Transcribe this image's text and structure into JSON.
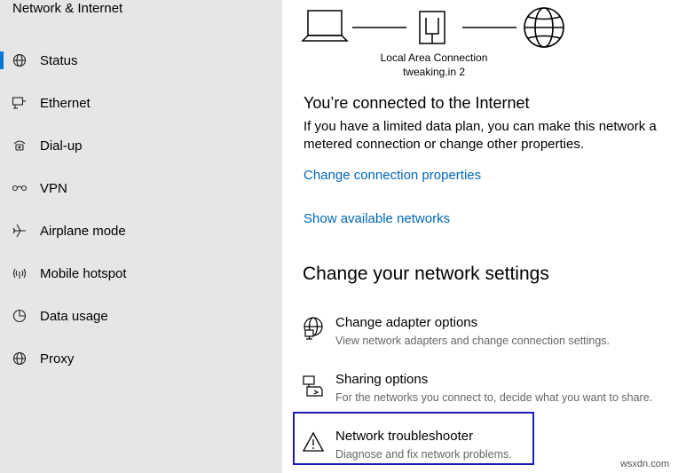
{
  "sidebar": {
    "title": "Network & Internet",
    "items": [
      {
        "label": "Status",
        "icon": "globe-icon",
        "selected": true
      },
      {
        "label": "Ethernet",
        "icon": "ethernet-icon"
      },
      {
        "label": "Dial-up",
        "icon": "dial-up-icon"
      },
      {
        "label": "VPN",
        "icon": "vpn-icon"
      },
      {
        "label": "Airplane mode",
        "icon": "airplane-icon"
      },
      {
        "label": "Mobile hotspot",
        "icon": "hotspot-icon"
      },
      {
        "label": "Data usage",
        "icon": "data-usage-icon"
      },
      {
        "label": "Proxy",
        "icon": "globe-icon"
      }
    ]
  },
  "diagram": {
    "connection_name": "Local Area Connection",
    "network_name": "tweaking.in 2"
  },
  "status": {
    "heading": "You’re connected to the Internet",
    "description": "If you have a limited data plan, you can make this network a metered connection or change other properties.",
    "change_properties_link": "Change connection properties",
    "show_networks_link": "Show available networks"
  },
  "settings": {
    "heading": "Change your network settings",
    "options": [
      {
        "title": "Change adapter options",
        "desc": "View network adapters and change connection settings.",
        "icon": "adapter-icon"
      },
      {
        "title": "Sharing options",
        "desc": "For the networks you connect to, decide what you want to share.",
        "icon": "sharing-icon"
      },
      {
        "title": "Network troubleshooter",
        "desc": "Diagnose and fix network problems.",
        "icon": "warning-icon"
      }
    ]
  },
  "watermark": "wsxdn.com",
  "colors": {
    "accent": "#0078d7",
    "link": "#0067b8",
    "sidebar_bg": "#e6e6e6",
    "highlight": "#1a1ab8"
  }
}
